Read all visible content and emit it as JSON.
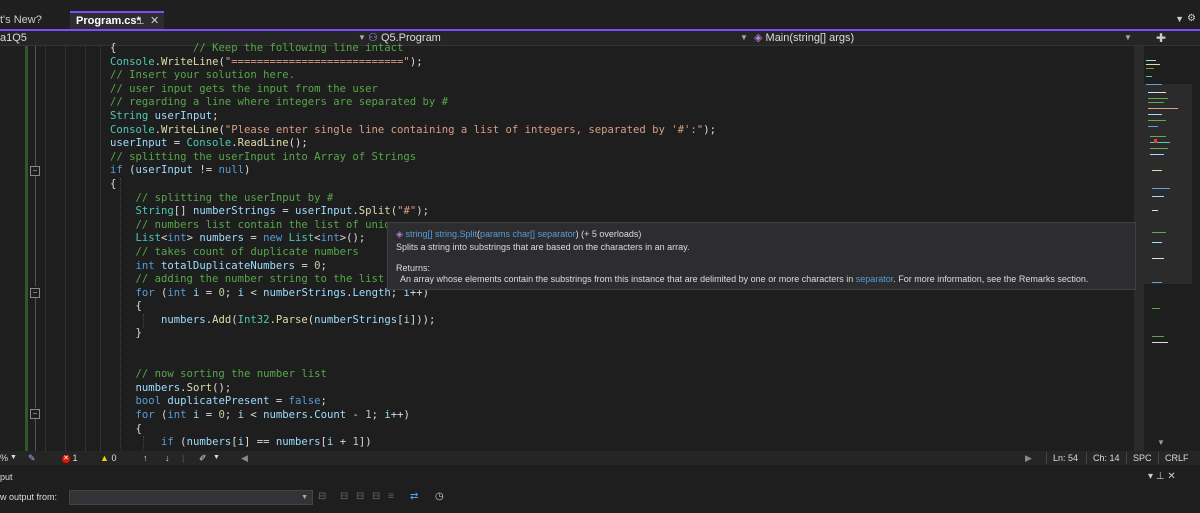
{
  "tabs": {
    "inactive": "t's New?",
    "active": "Program.cs*",
    "pin_icon": "pin-icon",
    "close_icon": "close-icon"
  },
  "navbar": {
    "project": "a1Q5",
    "class": "Q5.Program",
    "member": "Main(string[] args)"
  },
  "code": [
    "            // Keep the following line intact",
    "Console.WriteLine(\"===========================\");",
    "// Insert your solution here.",
    "// user input gets the input from the user",
    "// regarding a line where integers are separated by #",
    "String userInput;",
    "Console.WriteLine(\"Please enter single line containing a list of integers, separated by '#':\");",
    "userInput = Console.ReadLine();",
    "// splitting the userInput into Array of Strings",
    "if (userInput != null)",
    "{",
    "    // splitting the userInput by #",
    "    String[] numberStrings = userInput.Split(\"#\");",
    "    // numbers list contain the list of uniq",
    "    List<int> numbers = new List<int>();",
    "    // takes count of duplicate numbers",
    "    int totalDuplicateNumbers = 0;",
    "    // adding the number string to the list a",
    "    for (int i = 0; i < numberStrings.Length; i++)",
    "    {",
    "        numbers.Add(Int32.Parse(numberStrings[i]));",
    "    }",
    "",
    "",
    "    // now sorting the number list",
    "    numbers.Sort();",
    "    bool duplicatePresent = false;",
    "    for (int i = 0; i < numbers.Count - 1; i++)",
    "    {",
    "        if (numbers[i] == numbers[i + 1])"
  ],
  "tooltip": {
    "sig_return": "string[]",
    "sig_method": "string.Split",
    "sig_params_kw": "params",
    "sig_params_type": "char[]",
    "sig_param": "separator",
    "sig_overloads": "(+ 5 overloads)",
    "description": "Splits a string into substrings that are based on the characters in an array.",
    "returns_label": "Returns:",
    "returns_text_1": "An array whose elements contain the substrings from this instance that are delimited by one or more characters in ",
    "returns_link": "separator",
    "returns_text_2": ". For more information, see the Remarks section."
  },
  "status": {
    "zoom": "%",
    "errors": "1",
    "warnings": "0",
    "line": "Ln: 54",
    "col": "Ch: 14",
    "spacing": "SPC",
    "eol": "CRLF"
  },
  "output": {
    "title": "put",
    "show_from_label": "w output from:",
    "selected_source": ""
  },
  "colors": {
    "accent": "#7c4dff",
    "keyword": "#569cd6",
    "type": "#4ec9b0",
    "string": "#d69d85",
    "comment": "#57a64a",
    "error": "#e51400"
  }
}
